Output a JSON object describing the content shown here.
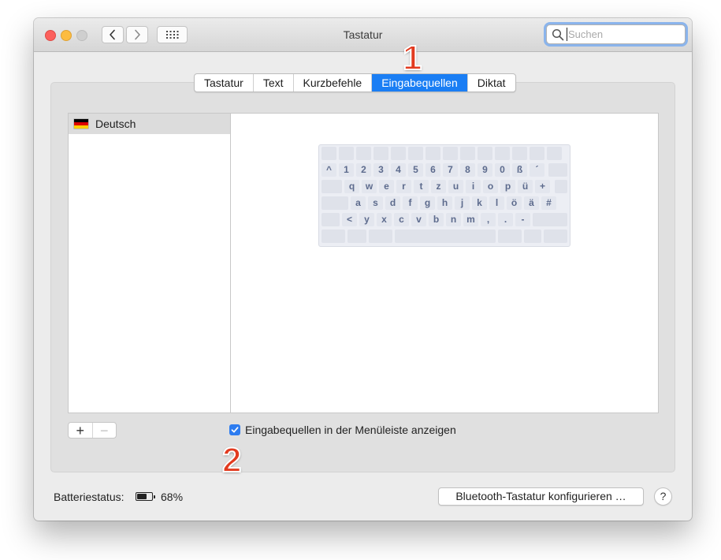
{
  "window": {
    "title": "Tastatur"
  },
  "search": {
    "placeholder": "Suchen"
  },
  "icons": {
    "close": "close-traffic-light",
    "minimize": "minimize-traffic-light",
    "zoom": "zoom-traffic-light",
    "back": "chevron-left-icon",
    "forward": "chevron-right-icon",
    "show_all": "grid-icon",
    "search": "magnifier-icon",
    "flag": "german-flag-icon",
    "battery": "battery-icon",
    "check": "checkmark-icon"
  },
  "tabs": [
    {
      "label": "Tastatur",
      "active": false
    },
    {
      "label": "Text",
      "active": false
    },
    {
      "label": "Kurzbefehle",
      "active": false
    },
    {
      "label": "Eingabequellen",
      "active": true
    },
    {
      "label": "Diktat",
      "active": false
    }
  ],
  "input_sources": [
    {
      "label": "Deutsch",
      "selected": true
    }
  ],
  "keyboard_rows": [
    [],
    [
      "^",
      "1",
      "2",
      "3",
      "4",
      "5",
      "6",
      "7",
      "8",
      "9",
      "0",
      "ß",
      "´"
    ],
    [
      "q",
      "w",
      "e",
      "r",
      "t",
      "z",
      "u",
      "i",
      "o",
      "p",
      "ü",
      "+"
    ],
    [
      "a",
      "s",
      "d",
      "f",
      "g",
      "h",
      "j",
      "k",
      "l",
      "ö",
      "ä",
      "#"
    ],
    [
      "<",
      "y",
      "x",
      "c",
      "v",
      "b",
      "n",
      "m",
      ",",
      ".",
      "-"
    ],
    []
  ],
  "list_controls": {
    "add_label": "+",
    "remove_label": "−"
  },
  "menubar_checkbox": {
    "label": "Eingabequellen in der Menüleiste anzeigen",
    "checked": true
  },
  "battery": {
    "label": "Batteriestatus:",
    "percent_text": "68%",
    "level": 0.68
  },
  "bluetooth_button": {
    "label": "Bluetooth-Tastatur konfigurieren …"
  },
  "help_button": {
    "label": "?"
  },
  "annotations": [
    {
      "label": "1"
    },
    {
      "label": "2"
    }
  ],
  "colors": {
    "accent": "#1a7ef4",
    "close": "#fc605c",
    "minimize": "#fdbc40",
    "annotation": "#e23a1f",
    "key_text": "#5d6b8d"
  }
}
